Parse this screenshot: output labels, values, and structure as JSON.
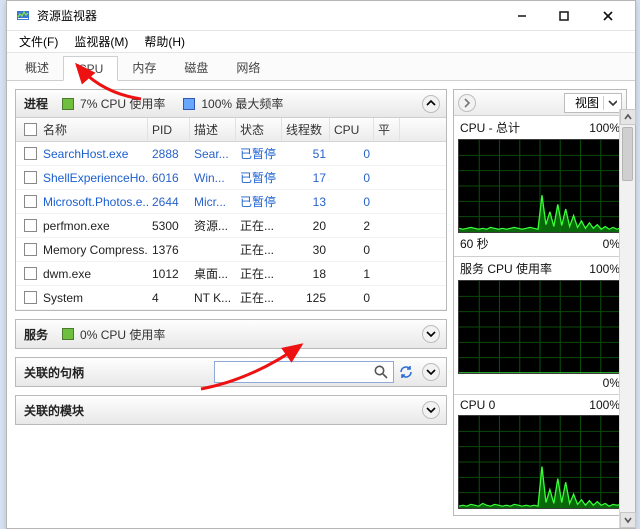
{
  "app": {
    "title": "资源监视器"
  },
  "window_controls": {
    "min": "minimize",
    "max": "maximize",
    "close": "close"
  },
  "menu": {
    "file": "文件(F)",
    "monitor": "监视器(M)",
    "help": "帮助(H)"
  },
  "tabs": {
    "overview": "概述",
    "cpu": "CPU",
    "memory": "内存",
    "disk": "磁盘",
    "network": "网络",
    "active": "cpu"
  },
  "panels": {
    "processes": {
      "title": "进程",
      "stat1": "7% CPU 使用率",
      "stat2": "100% 最大频率"
    },
    "services": {
      "title": "服务",
      "stat": "0% CPU 使用率"
    },
    "handles": {
      "title": "关联的句柄",
      "search_placeholder": ""
    },
    "modules": {
      "title": "关联的模块"
    }
  },
  "columns": {
    "name": "名称",
    "pid": "PID",
    "desc": "描述",
    "status": "状态",
    "threads": "线程数",
    "cpu": "CPU",
    "avg": "平"
  },
  "status_labels": {
    "paused": "已暂停",
    "running": "正在..."
  },
  "processes": [
    {
      "name": "SearchHost.exe",
      "pid": "2888",
      "desc": "Sear...",
      "status": "paused",
      "threads": "51",
      "cpu": "0",
      "link": true
    },
    {
      "name": "ShellExperienceHo...",
      "pid": "6016",
      "desc": "Win...",
      "status": "paused",
      "threads": "17",
      "cpu": "0",
      "link": true
    },
    {
      "name": "Microsoft.Photos.e...",
      "pid": "2644",
      "desc": "Micr...",
      "status": "paused",
      "threads": "13",
      "cpu": "0",
      "link": true
    },
    {
      "name": "perfmon.exe",
      "pid": "5300",
      "desc": "资源...",
      "status": "running",
      "threads": "20",
      "cpu": "2",
      "link": false
    },
    {
      "name": "Memory Compress...",
      "pid": "1376",
      "desc": "",
      "status": "running",
      "threads": "30",
      "cpu": "0",
      "link": false
    },
    {
      "name": "dwm.exe",
      "pid": "1012",
      "desc": "桌面...",
      "status": "running",
      "threads": "18",
      "cpu": "1",
      "link": false
    },
    {
      "name": "System",
      "pid": "4",
      "desc": "NT K...",
      "status": "running",
      "threads": "125",
      "cpu": "0",
      "link": false
    }
  ],
  "right": {
    "view_label": "视图",
    "cards": [
      {
        "title": "CPU - 总计",
        "right": "100%",
        "foot_l": "60 秒",
        "foot_r": "0%"
      },
      {
        "title": "服务 CPU 使用率",
        "right": "100%",
        "foot_l": "",
        "foot_r": "0%"
      },
      {
        "title": "CPU 0",
        "right": "100%",
        "foot_l": "",
        "foot_r": ""
      }
    ]
  },
  "chart_data": [
    {
      "type": "area",
      "title": "CPU - 总计",
      "ylim": [
        0,
        100
      ],
      "xrange_seconds": 60,
      "values": [
        4,
        3,
        4,
        5,
        4,
        3,
        4,
        3,
        5,
        4,
        3,
        4,
        3,
        4,
        5,
        4,
        3,
        4,
        5,
        4,
        3,
        40,
        8,
        22,
        6,
        30,
        7,
        25,
        6,
        18,
        5,
        12,
        4,
        10,
        4,
        8,
        3,
        6,
        3,
        5,
        3,
        5
      ]
    },
    {
      "type": "area",
      "title": "服务 CPU 使用率",
      "ylim": [
        0,
        100
      ],
      "xrange_seconds": 60,
      "values": [
        0,
        0,
        0,
        0,
        0,
        0,
        0,
        0,
        0,
        0,
        0,
        0,
        0,
        0,
        0,
        0,
        0,
        0,
        0,
        0,
        0,
        0,
        0,
        0,
        0,
        0,
        0,
        0,
        0,
        0,
        0,
        0,
        0,
        0,
        0,
        0,
        0,
        0,
        0,
        0,
        0,
        0
      ]
    },
    {
      "type": "area",
      "title": "CPU 0",
      "ylim": [
        0,
        100
      ],
      "xrange_seconds": 60,
      "values": [
        2,
        3,
        2,
        4,
        3,
        2,
        5,
        3,
        2,
        4,
        3,
        2,
        3,
        2,
        4,
        3,
        2,
        3,
        2,
        3,
        2,
        45,
        6,
        20,
        5,
        32,
        6,
        28,
        5,
        15,
        4,
        9,
        3,
        8,
        3,
        7,
        3,
        5,
        2,
        4,
        3,
        4
      ]
    }
  ]
}
